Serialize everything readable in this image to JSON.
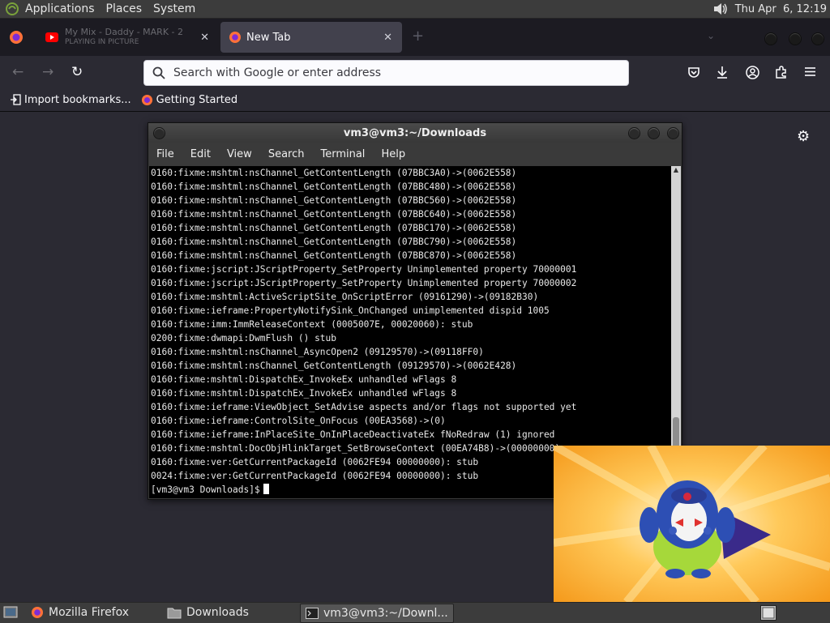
{
  "top_panel": {
    "menus": [
      "Applications",
      "Places",
      "System"
    ],
    "clock": "Thu Apr  6, 12:19",
    "icons": [
      "distro-logo-icon",
      "volume-icon"
    ]
  },
  "browser": {
    "tabs": [
      {
        "title": "My Mix - Daddy - MARK - 2",
        "subtitle": "PLAYING IN PICTURE",
        "active": false,
        "icon": "youtube-icon"
      },
      {
        "title": "New Tab",
        "active": true,
        "icon": "firefox-icon"
      }
    ],
    "url_placeholder": "Search with Google or enter address",
    "bookmarks": [
      "Import bookmarks...",
      "Getting Started"
    ],
    "colors": {
      "accent": "#42414d",
      "toolbar": "#2b2a33"
    }
  },
  "terminal": {
    "title": "vm3@vm3:~/Downloads",
    "menus": [
      "File",
      "Edit",
      "View",
      "Search",
      "Terminal",
      "Help"
    ],
    "lines": [
      "0160:fixme:mshtml:nsChannel_GetContentLength (07BBC3A0)->(0062E558)",
      "0160:fixme:mshtml:nsChannel_GetContentLength (07BBC480)->(0062E558)",
      "0160:fixme:mshtml:nsChannel_GetContentLength (07BBC560)->(0062E558)",
      "0160:fixme:mshtml:nsChannel_GetContentLength (07BBC640)->(0062E558)",
      "0160:fixme:mshtml:nsChannel_GetContentLength (07BBC170)->(0062E558)",
      "0160:fixme:mshtml:nsChannel_GetContentLength (07BBC790)->(0062E558)",
      "0160:fixme:mshtml:nsChannel_GetContentLength (07BBC870)->(0062E558)",
      "0160:fixme:jscript:JScriptProperty_SetProperty Unimplemented property 70000001",
      "0160:fixme:jscript:JScriptProperty_SetProperty Unimplemented property 70000002",
      "0160:fixme:mshtml:ActiveScriptSite_OnScriptError (09161290)->(09182B30)",
      "0160:fixme:ieframe:PropertyNotifySink_OnChanged unimplemented dispid 1005",
      "0160:fixme:imm:ImmReleaseContext (0005007E, 00020060): stub",
      "0200:fixme:dwmapi:DwmFlush () stub",
      "0160:fixme:mshtml:nsChannel_AsyncOpen2 (09129570)->(09118FF0)",
      "0160:fixme:mshtml:nsChannel_GetContentLength (09129570)->(0062E428)",
      "0160:fixme:mshtml:DispatchEx_InvokeEx unhandled wFlags 8",
      "0160:fixme:mshtml:DispatchEx_InvokeEx unhandled wFlags 8",
      "0160:fixme:ieframe:ViewObject_SetAdvise aspects and/or flags not supported yet",
      "0160:fixme:ieframe:ControlSite_OnFocus (00EA3568)->(0)",
      "0160:fixme:ieframe:InPlaceSite_OnInPlaceDeactivateEx fNoRedraw (1) ignored",
      "0160:fixme:mshtml:DocObjHlinkTarget_SetBrowseContext (00EA74B8)->(00000000)",
      "0160:fixme:ver:GetCurrentPackageId (0062FE94 00000000): stub",
      "0024:fixme:ver:GetCurrentPackageId (0062FE94 00000000): stub"
    ],
    "prompt": "[vm3@vm3 Downloads]$"
  },
  "taskbar": {
    "tasks": [
      {
        "label": "Mozilla Firefox",
        "icon": "firefox-icon"
      },
      {
        "label": "Downloads",
        "icon": "folder-icon"
      },
      {
        "label": "vm3@vm3:~/Downl...",
        "icon": "terminal-icon"
      }
    ]
  }
}
